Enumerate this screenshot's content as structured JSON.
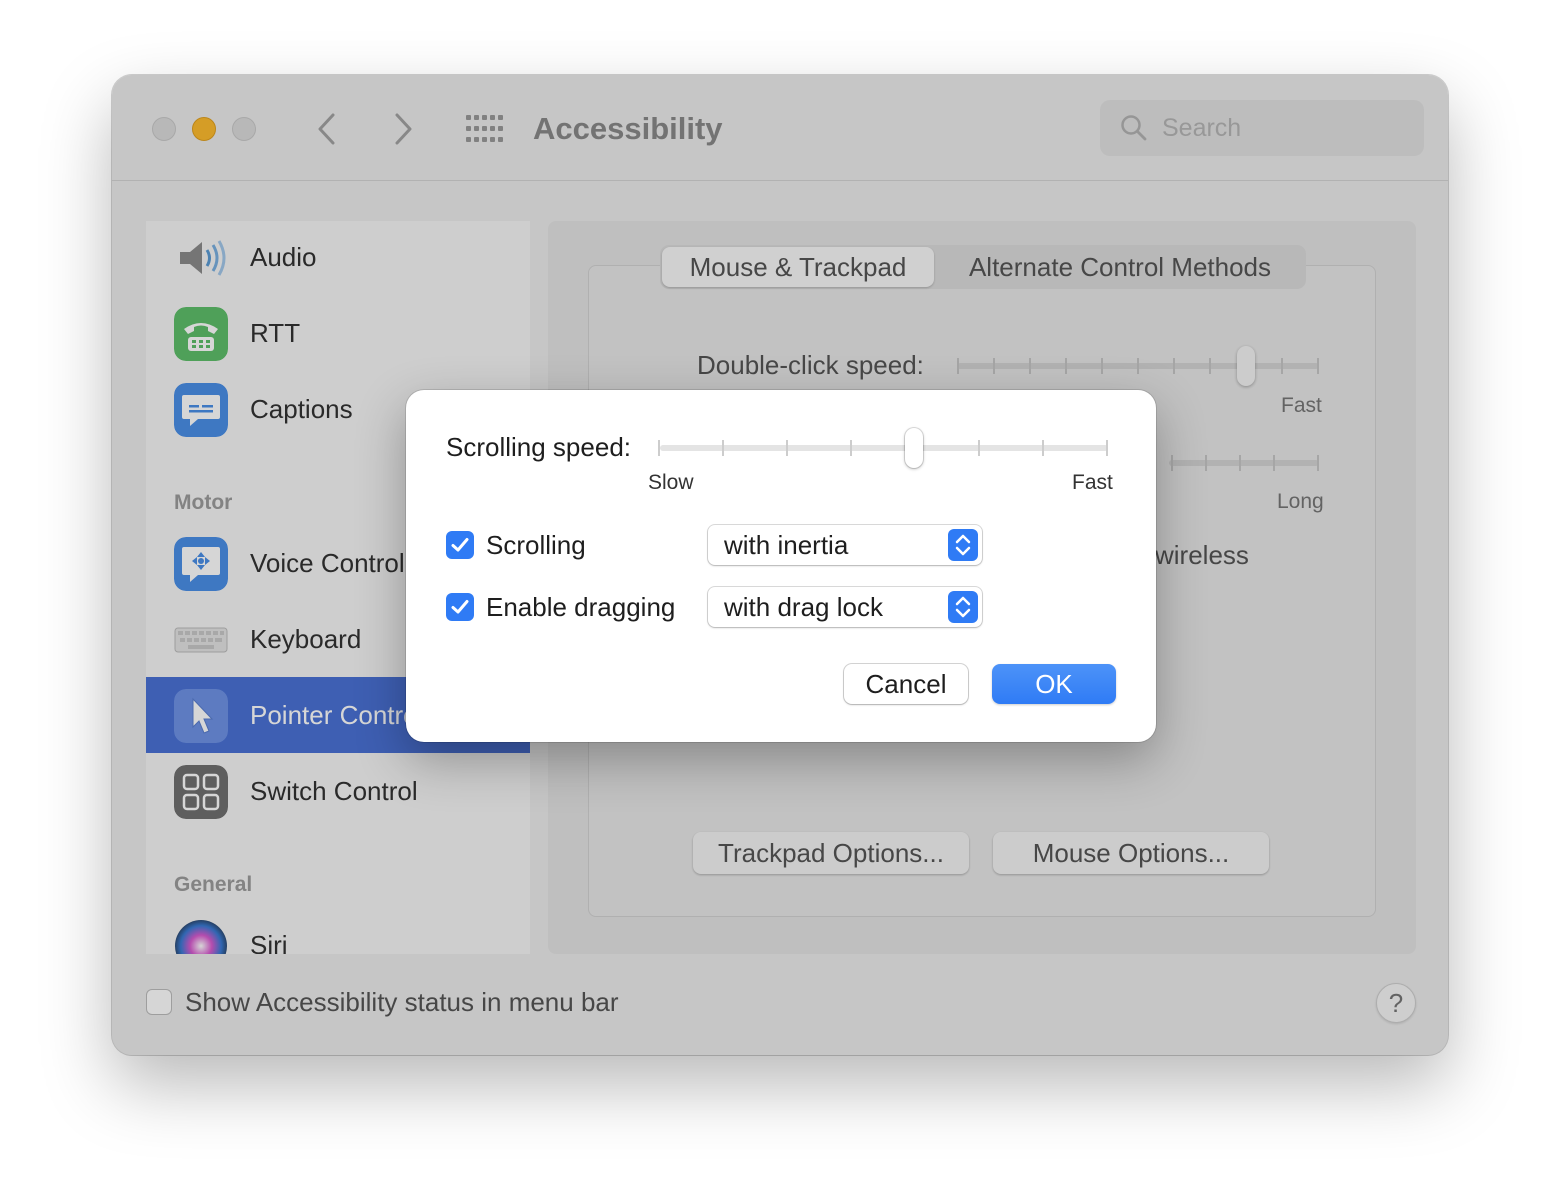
{
  "window": {
    "title": "Accessibility",
    "search_placeholder": "Search"
  },
  "sidebar": {
    "items": [
      {
        "label": "Audio",
        "icon": "speaker-icon"
      },
      {
        "label": "RTT",
        "icon": "telephone-icon"
      },
      {
        "label": "Captions",
        "icon": "captions-icon"
      },
      {
        "label": "Voice Control",
        "icon": "voice-control-icon"
      },
      {
        "label": "Keyboard",
        "icon": "keyboard-icon"
      },
      {
        "label": "Pointer Control",
        "icon": "pointer-icon"
      },
      {
        "label": "Switch Control",
        "icon": "switch-control-icon"
      },
      {
        "label": "Siri",
        "icon": "siri-icon"
      }
    ],
    "sections": {
      "motor": "Motor",
      "general": "General"
    },
    "selected": "Pointer Control"
  },
  "content": {
    "tabs": [
      "Mouse & Trackpad",
      "Alternate Control Methods"
    ],
    "active_tab": "Mouse & Trackpad",
    "double_click_label": "Double-click speed:",
    "double_click_fast": "Fast",
    "double_click_value": 0.8,
    "delay_long": "Long",
    "wireless_partial": "wireless",
    "trackpad_options": "Trackpad Options...",
    "mouse_options": "Mouse Options..."
  },
  "footer": {
    "status_label": "Show Accessibility status in menu bar",
    "status_checked": false,
    "help": "?"
  },
  "sheet": {
    "scrolling_speed_label": "Scrolling speed:",
    "slow": "Slow",
    "fast": "Fast",
    "scrolling_speed_value": 0.57,
    "scrolling_label": "Scrolling",
    "scrolling_checked": true,
    "scrolling_option": "with inertia",
    "dragging_label": "Enable dragging",
    "dragging_checked": true,
    "dragging_option": "with drag lock",
    "cancel": "Cancel",
    "ok": "OK"
  },
  "colors": {
    "accent": "#2f7bf5",
    "sidebar_selected": "#4a72d6",
    "traffic_yellow": "#febc2e"
  }
}
